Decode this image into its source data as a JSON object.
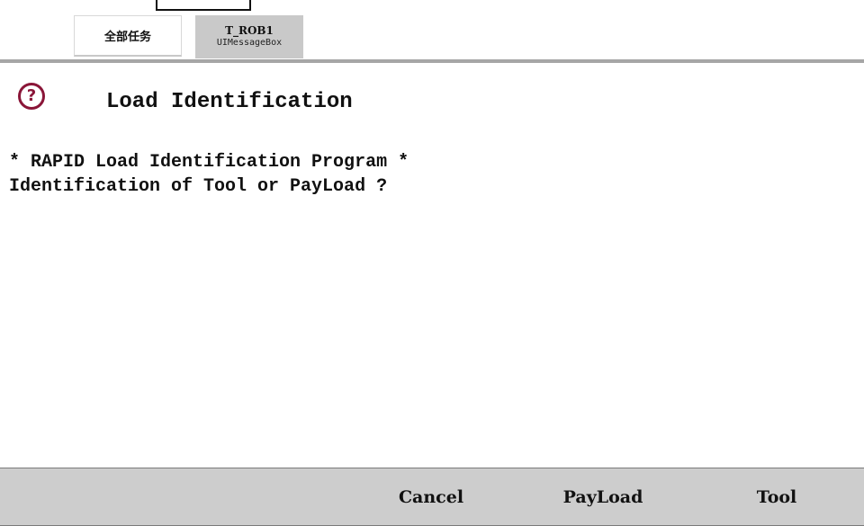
{
  "tabs": {
    "all_tasks": "全部任务",
    "task_name": "T_ROB1",
    "task_sub": "UIMessageBox"
  },
  "dialog": {
    "icon": "question-icon",
    "icon_glyph": "?",
    "title": "Load Identification",
    "message_lines": [
      "* RAPID Load Identification Program *",
      "Identification of Tool or PayLoad ?"
    ]
  },
  "buttons": {
    "cancel": "Cancel",
    "payload": "PayLoad",
    "tool": "Tool"
  },
  "colors": {
    "icon_accent": "#8a1538",
    "bar_background": "#cdcdcd",
    "active_tab": "#c9c9c9"
  }
}
